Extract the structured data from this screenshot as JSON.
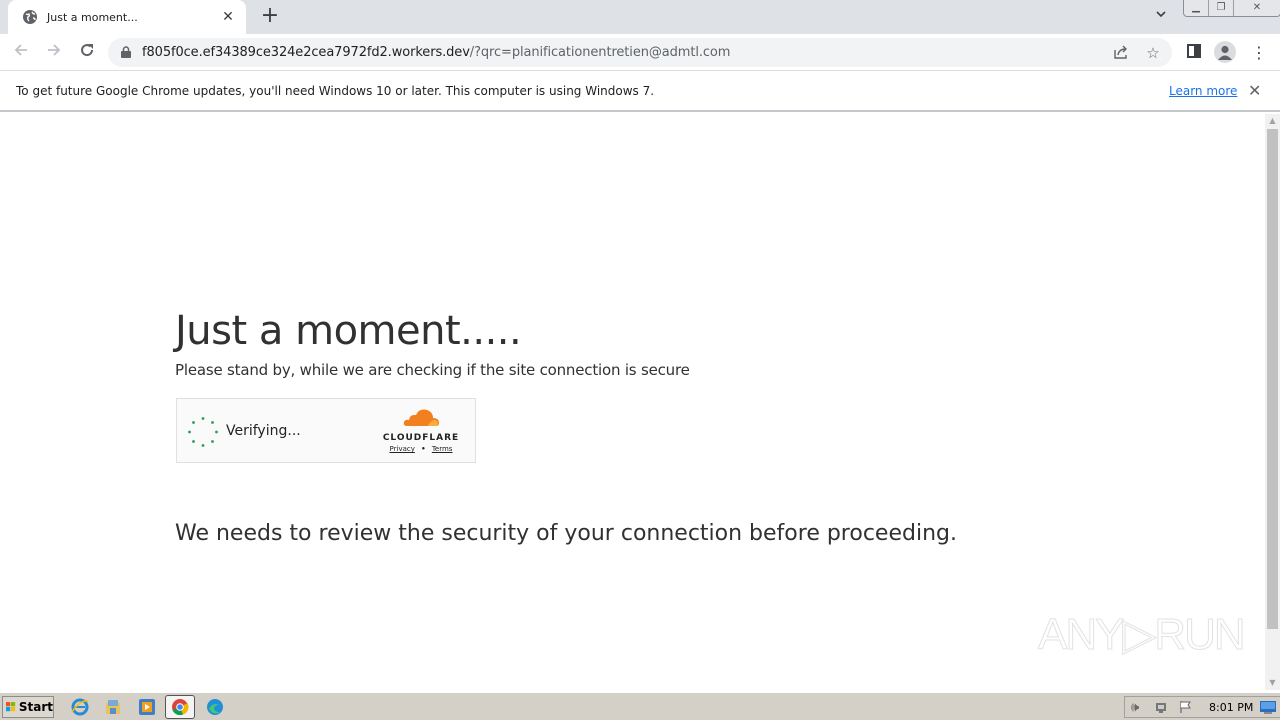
{
  "browser": {
    "tab": {
      "title": "Just a moment...",
      "icon": "globe-icon"
    },
    "new_tab_label": "+",
    "address": {
      "host": "f805f0ce.ef34389ce324e2cea7972fd2.workers.dev",
      "path": "/?qrc=planificationentretien@admtl.com"
    },
    "infobar": {
      "message": "To get future Google Chrome updates, you'll need Windows 10 or later. This computer is using Windows 7.",
      "link": "Learn more"
    }
  },
  "page": {
    "heading": "Just a moment.....",
    "subheading": "Please stand by, while we are checking if the site connection is secure",
    "widget": {
      "status": "Verifying...",
      "brand": "CLOUDFLARE",
      "privacy": "Privacy",
      "separator": "•",
      "terms": "Terms",
      "brand_color": "#f38020"
    },
    "warning": "We needs to review the security of your connection before proceeding."
  },
  "watermark": "ANY▷RUN",
  "taskbar": {
    "start_label": "Start",
    "clock": "8:01 PM",
    "apps": [
      "internet-explorer",
      "file-explorer",
      "media-player",
      "chrome",
      "edge"
    ]
  }
}
